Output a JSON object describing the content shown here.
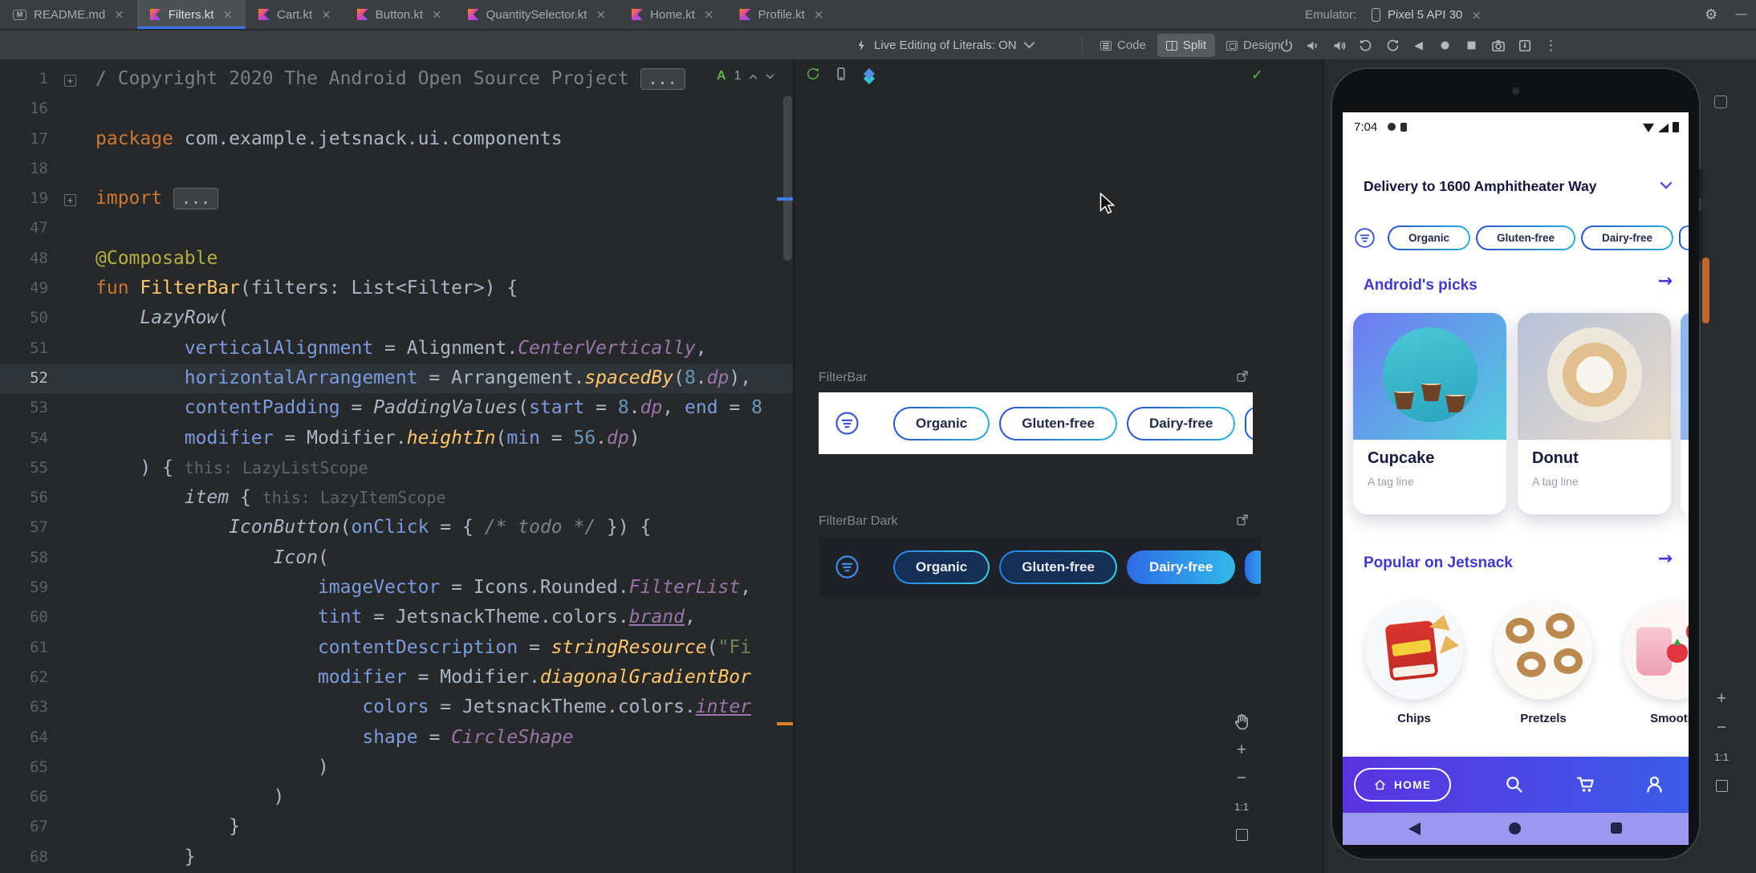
{
  "colors": {
    "accent_blue": "#3574f0",
    "kotlin_orange": "#cc7832",
    "jetsnack_primary": "#3f38d4",
    "chip_border_start": "#2b50d0",
    "chip_border_end": "#2bb3d8",
    "nav_gradient_start": "#5a33e0",
    "nav_gradient_end": "#3c5ce8",
    "ok_green": "#57b94c",
    "scroll_mark_orange": "#d9822b"
  },
  "tabs": {
    "files": [
      {
        "label": "README.md",
        "icon": "markdown",
        "active": false
      },
      {
        "label": "Filters.kt",
        "icon": "kotlin",
        "active": true
      },
      {
        "label": "Cart.kt",
        "icon": "kotlin",
        "active": false
      },
      {
        "label": "Button.kt",
        "icon": "kotlin",
        "active": false
      },
      {
        "label": "QuantitySelector.kt",
        "icon": "kotlin",
        "active": false
      },
      {
        "label": "Home.kt",
        "icon": "kotlin",
        "active": false
      },
      {
        "label": "Profile.kt",
        "icon": "kotlin",
        "active": false
      }
    ],
    "emulator_label": "Emulator:",
    "emulator_tab": {
      "label": "Pixel 5 API 30"
    }
  },
  "toolbar": {
    "live_edit_label": "Live Editing of Literals: ON",
    "views": [
      {
        "label": "Code",
        "icon": "code",
        "active": false
      },
      {
        "label": "Split",
        "icon": "split",
        "active": true
      },
      {
        "label": "Design",
        "icon": "design",
        "active": false
      }
    ],
    "emulator_controls": [
      "power",
      "volume-down",
      "volume-up",
      "rotate-left",
      "rotate-right",
      "back",
      "home",
      "overview",
      "screenshot",
      "snapshot",
      "more"
    ]
  },
  "editor": {
    "current_line": 52,
    "widget": {
      "grade": "A",
      "count": "1"
    },
    "lines": [
      {
        "n": 1,
        "f": "plus",
        "s": [
          {
            "c": "cm",
            "t": "/ Copyright 2020 The Android Open Source Project "
          },
          {
            "c": "fold",
            "t": "..."
          }
        ]
      },
      {
        "n": 16,
        "s": []
      },
      {
        "n": 17,
        "s": [
          {
            "c": "kw",
            "t": "package "
          },
          {
            "c": "tx",
            "t": "com.example.jetsnack.ui.components"
          }
        ]
      },
      {
        "n": 18,
        "s": []
      },
      {
        "n": 19,
        "f": "plus",
        "s": [
          {
            "c": "kw",
            "t": "import "
          },
          {
            "c": "fold",
            "t": "..."
          }
        ]
      },
      {
        "n": 47,
        "s": []
      },
      {
        "n": 48,
        "s": [
          {
            "c": "ann",
            "t": "@Composable"
          }
        ]
      },
      {
        "n": 49,
        "s": [
          {
            "c": "kw",
            "t": "fun "
          },
          {
            "c": "fn",
            "t": "FilterBar"
          },
          {
            "c": "tx",
            "t": "(filters: List<Filter>) {"
          }
        ]
      },
      {
        "n": 50,
        "s": [
          {
            "c": "tx",
            "t": "    "
          },
          {
            "c": "comp",
            "t": "LazyRow"
          },
          {
            "c": "tx",
            "t": "("
          }
        ]
      },
      {
        "n": 51,
        "s": [
          {
            "c": "tx",
            "t": "        "
          },
          {
            "c": "arg",
            "t": "verticalAlignment"
          },
          {
            "c": "tx",
            "t": " = Alignment."
          },
          {
            "c": "prop",
            "t": "CenterVertically"
          },
          {
            "c": "tx",
            "t": ","
          }
        ]
      },
      {
        "n": 52,
        "s": [
          {
            "c": "tx",
            "t": "        "
          },
          {
            "c": "arg",
            "t": "horizontalArrangement"
          },
          {
            "c": "tx",
            "t": " = Arrangement."
          },
          {
            "c": "fni",
            "t": "spacedBy"
          },
          {
            "c": "tx",
            "t": "("
          },
          {
            "c": "num",
            "t": "8"
          },
          {
            "c": "tx",
            "t": "."
          },
          {
            "c": "prop",
            "t": "dp"
          },
          {
            "c": "tx",
            "t": "),"
          }
        ]
      },
      {
        "n": 53,
        "s": [
          {
            "c": "tx",
            "t": "        "
          },
          {
            "c": "arg",
            "t": "contentPadding"
          },
          {
            "c": "tx",
            "t": " = "
          },
          {
            "c": "comp",
            "t": "PaddingValues"
          },
          {
            "c": "tx",
            "t": "("
          },
          {
            "c": "arg",
            "t": "start"
          },
          {
            "c": "tx",
            "t": " = "
          },
          {
            "c": "num",
            "t": "8"
          },
          {
            "c": "tx",
            "t": "."
          },
          {
            "c": "prop",
            "t": "dp"
          },
          {
            "c": "tx",
            "t": ", "
          },
          {
            "c": "arg",
            "t": "end"
          },
          {
            "c": "tx",
            "t": " = "
          },
          {
            "c": "num",
            "t": "8"
          }
        ]
      },
      {
        "n": 54,
        "s": [
          {
            "c": "tx",
            "t": "        "
          },
          {
            "c": "arg",
            "t": "modifier"
          },
          {
            "c": "tx",
            "t": " = Modifier."
          },
          {
            "c": "fni",
            "t": "heightIn"
          },
          {
            "c": "tx",
            "t": "("
          },
          {
            "c": "arg",
            "t": "min"
          },
          {
            "c": "tx",
            "t": " = "
          },
          {
            "c": "num",
            "t": "56"
          },
          {
            "c": "tx",
            "t": "."
          },
          {
            "c": "prop",
            "t": "dp"
          },
          {
            "c": "tx",
            "t": ")"
          }
        ]
      },
      {
        "n": 55,
        "s": [
          {
            "c": "tx",
            "t": "    ) { "
          },
          {
            "c": "hint",
            "t": "this: LazyListScope"
          }
        ]
      },
      {
        "n": 56,
        "s": [
          {
            "c": "tx",
            "t": "        "
          },
          {
            "c": "comp",
            "t": "item"
          },
          {
            "c": "tx",
            "t": " { "
          },
          {
            "c": "hint",
            "t": "this: LazyItemScope"
          }
        ]
      },
      {
        "n": 57,
        "s": [
          {
            "c": "tx",
            "t": "            "
          },
          {
            "c": "comp",
            "t": "IconButton"
          },
          {
            "c": "tx",
            "t": "("
          },
          {
            "c": "arg",
            "t": "onClick"
          },
          {
            "c": "tx",
            "t": " = { "
          },
          {
            "c": "cmi",
            "t": "/* todo */"
          },
          {
            "c": "tx",
            "t": " }) {"
          }
        ]
      },
      {
        "n": 58,
        "s": [
          {
            "c": "tx",
            "t": "                "
          },
          {
            "c": "comp",
            "t": "Icon"
          },
          {
            "c": "tx",
            "t": "("
          }
        ]
      },
      {
        "n": 59,
        "s": [
          {
            "c": "tx",
            "t": "                    "
          },
          {
            "c": "arg",
            "t": "imageVector"
          },
          {
            "c": "tx",
            "t": " = Icons.Rounded."
          },
          {
            "c": "prop",
            "t": "FilterList"
          },
          {
            "c": "tx",
            "t": ","
          }
        ]
      },
      {
        "n": 60,
        "s": [
          {
            "c": "tx",
            "t": "                    "
          },
          {
            "c": "arg",
            "t": "tint"
          },
          {
            "c": "tx",
            "t": " = JetsnackTheme.colors."
          },
          {
            "c": "propu",
            "t": "brand"
          },
          {
            "c": "tx",
            "t": ","
          }
        ]
      },
      {
        "n": 61,
        "s": [
          {
            "c": "tx",
            "t": "                    "
          },
          {
            "c": "arg",
            "t": "contentDescription"
          },
          {
            "c": "tx",
            "t": " = "
          },
          {
            "c": "fni",
            "t": "stringResource"
          },
          {
            "c": "tx",
            "t": "("
          },
          {
            "c": "str",
            "t": "\"Fi"
          }
        ]
      },
      {
        "n": 62,
        "s": [
          {
            "c": "tx",
            "t": "                    "
          },
          {
            "c": "arg",
            "t": "modifier"
          },
          {
            "c": "tx",
            "t": " = Modifier."
          },
          {
            "c": "fni",
            "t": "diagonalGradientBor"
          }
        ]
      },
      {
        "n": 63,
        "s": [
          {
            "c": "tx",
            "t": "                        "
          },
          {
            "c": "arg",
            "t": "colors"
          },
          {
            "c": "tx",
            "t": " = JetsnackTheme.colors."
          },
          {
            "c": "propu",
            "t": "inter"
          }
        ]
      },
      {
        "n": 64,
        "s": [
          {
            "c": "tx",
            "t": "                        "
          },
          {
            "c": "arg",
            "t": "shape"
          },
          {
            "c": "tx",
            "t": " = "
          },
          {
            "c": "prop",
            "t": "CircleShape"
          }
        ]
      },
      {
        "n": 65,
        "s": [
          {
            "c": "tx",
            "t": "                    )"
          }
        ]
      },
      {
        "n": 66,
        "s": [
          {
            "c": "tx",
            "t": "                )"
          }
        ]
      },
      {
        "n": 67,
        "s": [
          {
            "c": "tx",
            "t": "            }"
          }
        ]
      },
      {
        "n": 68,
        "s": [
          {
            "c": "tx",
            "t": "        }"
          }
        ]
      }
    ]
  },
  "preview": {
    "toolbar_icons": [
      "build-refresh-icon",
      "device-icon",
      "layers-icon"
    ],
    "status_ok_icon": "check-icon",
    "light": {
      "label": "FilterBar",
      "chips": [
        "Organic",
        "Gluten-free",
        "Dairy-free"
      ]
    },
    "dark": {
      "label": "FilterBar Dark",
      "chips": [
        "Organic",
        "Gluten-free",
        "Dairy-free"
      ],
      "selected_chip": "Dairy-free"
    },
    "zoom_label": "1:1"
  },
  "emulator": {
    "time": "7:04",
    "delivery": "Delivery to 1600 Amphitheater Way",
    "chips": [
      "Organic",
      "Gluten-free",
      "Dairy-free"
    ],
    "picks": {
      "title": "Android's picks",
      "items": [
        {
          "name": "Cupcake",
          "tag": "A tag line",
          "photo": "cupcake"
        },
        {
          "name": "Donut",
          "tag": "A tag line",
          "photo": "donut"
        }
      ]
    },
    "popular": {
      "title": "Popular on Jetsnack",
      "items": [
        {
          "name": "Chips",
          "photo": "chips"
        },
        {
          "name": "Pretzels",
          "photo": "pretzels"
        },
        {
          "name": "Smooth",
          "photo": "smoothies"
        }
      ]
    },
    "nav": {
      "home_label": "HOME"
    },
    "zoom_label": "1:1"
  }
}
